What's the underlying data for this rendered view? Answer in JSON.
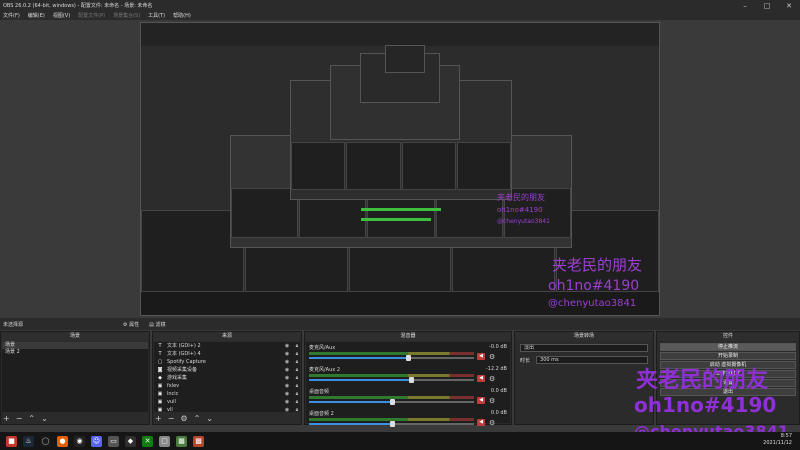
{
  "window": {
    "title": "OBS 26.0.2 (64-bit, windows) - 配置文件: 未命名 - 场景: 未命名"
  },
  "menu": [
    {
      "label": "文件(F)",
      "disabled": false
    },
    {
      "label": "编辑(E)",
      "disabled": false
    },
    {
      "label": "视图(V)",
      "disabled": false
    },
    {
      "label": "配置文件(P)",
      "disabled": true
    },
    {
      "label": "场景集合(S)",
      "disabled": true
    },
    {
      "label": "工具(T)",
      "disabled": false
    },
    {
      "label": "帮助(H)",
      "disabled": false
    }
  ],
  "status": {
    "no_source": "未选择源",
    "properties": "属性",
    "filters": "滤镜"
  },
  "scenes": {
    "title": "场景",
    "items": [
      "场景",
      "场景 2"
    ],
    "selected": 0
  },
  "sources": {
    "title": "来源",
    "items": [
      {
        "name": "文本 (GDI+) 2",
        "icon": "text-icon"
      },
      {
        "name": "文本 (GDI+) 4",
        "icon": "text-icon"
      },
      {
        "name": "Spotify Capture",
        "icon": "window-icon"
      },
      {
        "name": "视频采集设备",
        "icon": "camera-icon"
      },
      {
        "name": "游戏采集",
        "icon": "gamepad-icon"
      },
      {
        "name": "fxlev",
        "icon": "image-icon"
      },
      {
        "name": "lncic",
        "icon": "image-icon"
      },
      {
        "name": "vull",
        "icon": "image-icon"
      },
      {
        "name": "vll",
        "icon": "image-icon"
      }
    ]
  },
  "mixer": {
    "title": "混音器",
    "channels": [
      {
        "name": "麦克风/Aux",
        "db": "-0.0 dB",
        "level": 0.6
      },
      {
        "name": "麦克风/Aux 2",
        "db": "-12.2 dB",
        "level": 0.62
      },
      {
        "name": "桌面音频",
        "db": "0.0 dB",
        "level": 0.5
      },
      {
        "name": "桌面音频 2",
        "db": "0.0 dB",
        "level": 0.5
      }
    ]
  },
  "transitions": {
    "title": "场景转场",
    "type": "淡出",
    "duration_label": "时长",
    "duration": "300 ms"
  },
  "controls": {
    "title": "控件",
    "buttons": [
      "停止推流",
      "开始录制",
      "启动 虚拟摄像机",
      "工作室模式",
      "设置",
      "退出"
    ]
  },
  "watermark": {
    "line1": "夹老民的朋友",
    "line2": "oh1no#4190",
    "line3": "@chenyutao3841"
  },
  "tray": {
    "time": "8:57",
    "date": "2021/11/12"
  },
  "colors": {
    "accent": "#3b8ee0",
    "watermark": "#8f2fd6",
    "meter_green": "#2f7a2f"
  }
}
